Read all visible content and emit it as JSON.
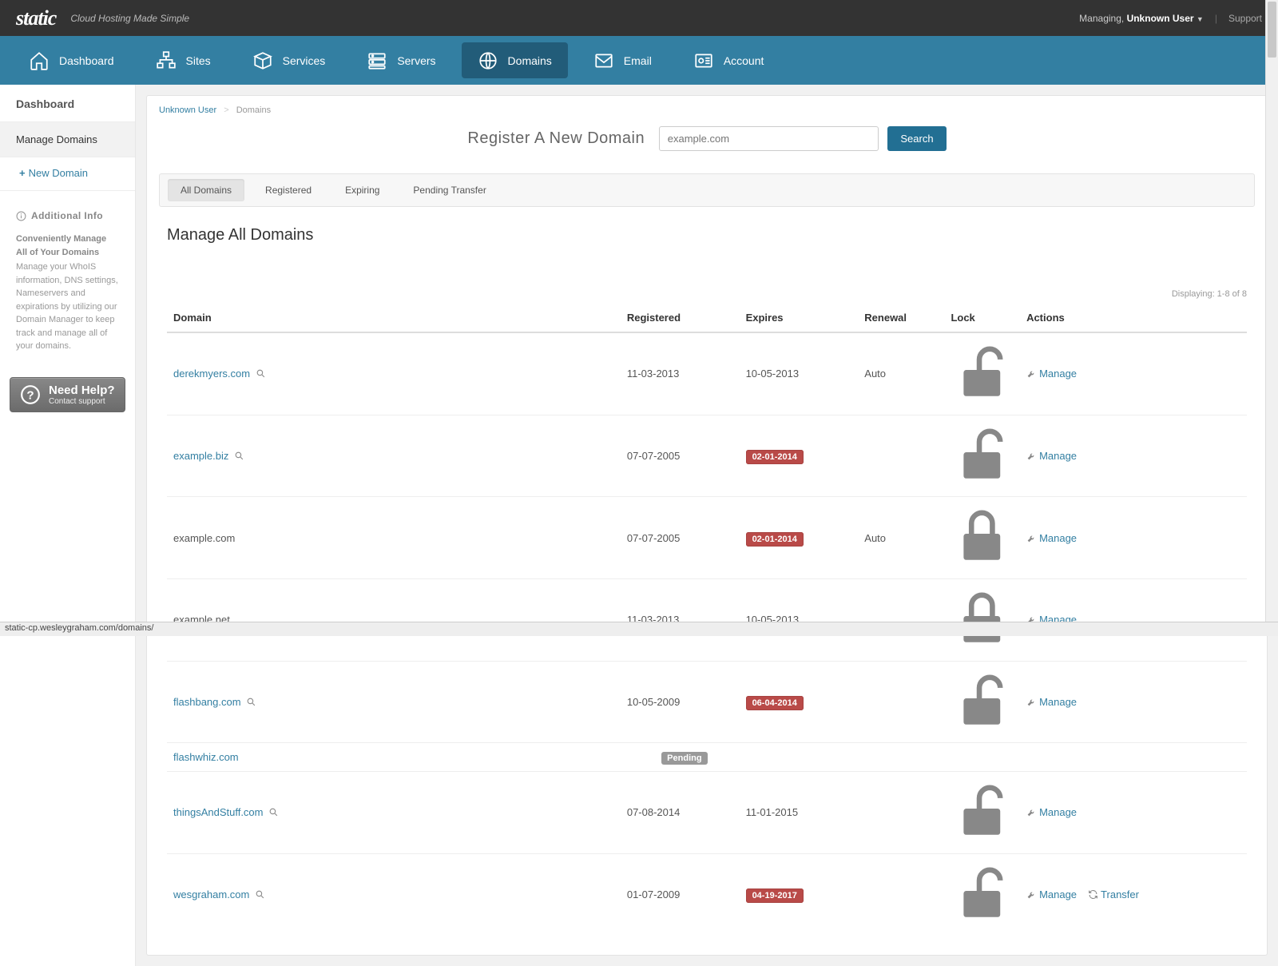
{
  "header": {
    "logo": "static",
    "tagline": "Cloud Hosting Made Simple",
    "managing_prefix": "Managing,",
    "user": "Unknown User",
    "support": "Support"
  },
  "nav": [
    {
      "id": "dashboard",
      "label": "Dashboard",
      "active": false
    },
    {
      "id": "sites",
      "label": "Sites",
      "active": false
    },
    {
      "id": "services",
      "label": "Services",
      "active": false
    },
    {
      "id": "servers",
      "label": "Servers",
      "active": false
    },
    {
      "id": "domains",
      "label": "Domains",
      "active": true
    },
    {
      "id": "email",
      "label": "Email",
      "active": false
    },
    {
      "id": "account",
      "label": "Account",
      "active": false
    }
  ],
  "sidebar": {
    "title": "Dashboard",
    "active_item": "Manage Domains",
    "new_domain": "New Domain",
    "info_title": "Additional Info",
    "info_bold": "Conveniently Manage All of Your Domains",
    "info_text": "Manage your WhoIS information, DNS settings, Nameservers and expirations by utilizing our Domain Manager to keep track and manage all of your domains.",
    "help_title": "Need Help?",
    "help_sub": "Contact support"
  },
  "breadcrumb": {
    "user": "Unknown User",
    "page": "Domains"
  },
  "register": {
    "title": "Register A New Domain",
    "placeholder": "example.com",
    "button": "Search"
  },
  "tabs": [
    {
      "label": "All Domains",
      "active": true
    },
    {
      "label": "Registered",
      "active": false
    },
    {
      "label": "Expiring",
      "active": false
    },
    {
      "label": "Pending Transfer",
      "active": false
    }
  ],
  "section_heading": "Manage All Domains",
  "displaying": "Displaying: 1-8 of 8",
  "columns": [
    "Domain",
    "Registered",
    "Expires",
    "Renewal",
    "Lock",
    "Actions"
  ],
  "action_labels": {
    "manage": "Manage",
    "transfer": "Transfer"
  },
  "rows": [
    {
      "domain": "derekmyers.com",
      "link": true,
      "mag": true,
      "registered": "11-03-2013",
      "expires": "10-05-2013",
      "expires_badge": false,
      "pending": false,
      "renewal": "Auto",
      "locked": false,
      "transfer": false
    },
    {
      "domain": "example.biz",
      "link": true,
      "mag": true,
      "registered": "07-07-2005",
      "expires": "02-01-2014",
      "expires_badge": true,
      "pending": false,
      "renewal": "",
      "locked": false,
      "transfer": false
    },
    {
      "domain": "example.com",
      "link": false,
      "mag": false,
      "registered": "07-07-2005",
      "expires": "02-01-2014",
      "expires_badge": true,
      "pending": false,
      "renewal": "Auto",
      "locked": true,
      "transfer": false
    },
    {
      "domain": "example.net",
      "link": false,
      "mag": false,
      "registered": "11-03-2013",
      "expires": "10-05-2013",
      "expires_badge": false,
      "pending": false,
      "renewal": "",
      "locked": true,
      "transfer": false
    },
    {
      "domain": "flashbang.com",
      "link": true,
      "mag": true,
      "registered": "10-05-2009",
      "expires": "06-04-2014",
      "expires_badge": true,
      "pending": false,
      "renewal": "",
      "locked": false,
      "transfer": false
    },
    {
      "domain": "flashwhiz.com",
      "link": true,
      "mag": false,
      "registered": "",
      "expires": "",
      "expires_badge": false,
      "pending": true,
      "pending_label": "Pending",
      "renewal": "",
      "locked": null,
      "transfer": false
    },
    {
      "domain": "thingsAndStuff.com",
      "link": true,
      "mag": true,
      "registered": "07-08-2014",
      "expires": "11-01-2015",
      "expires_badge": false,
      "pending": false,
      "renewal": "",
      "locked": false,
      "transfer": false
    },
    {
      "domain": "wesgraham.com",
      "link": true,
      "mag": true,
      "registered": "01-07-2009",
      "expires": "04-19-2017",
      "expires_badge": true,
      "pending": false,
      "renewal": "",
      "locked": false,
      "transfer": true
    }
  ],
  "status_bar": "static-cp.wesleygraham.com/domains/"
}
